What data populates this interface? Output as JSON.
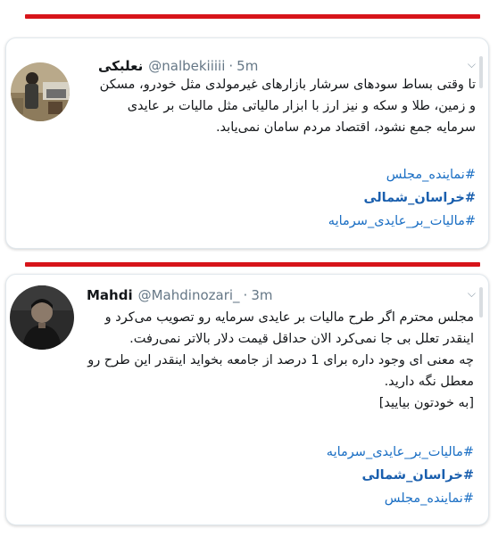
{
  "tweet1": {
    "display_name": "نعلبکی",
    "handle": "@nalbekiiiii",
    "time": "5m",
    "text": "تا وقتی بساط سودهای سرشار بازارهای غیرمولدی مثل خودرو، مسکن و زمین، طلا و سکه و نیز ارز با ابزار مالیاتی مثل مالیات بر عایدی سرمایه جمع نشود، اقتصاد مردم سامان نمی‌یابد.",
    "hashtags": [
      "#نماینده_مجلس",
      "#خراسان_شمالی",
      "#مالیات_بر_عایدی_سرمایه"
    ]
  },
  "tweet2": {
    "display_name": "Mahdi",
    "handle": "@Mahdinozari_",
    "time": "3m",
    "text_lines": [
      "مجلس محترم اگر طرح مالیات بر عایدی سرمایه رو تصویب می‌کرد و اینقدر تعلل بی جا نمی‌کرد الان حداقل قیمت دلار بالاتر نمی‌رفت.",
      "چه معنی ای وجود داره برای 1 درصد از جامعه بخواید اینقدر این طرح رو معطل نگه دارید.",
      "[به خودتون بیایید]"
    ],
    "hashtags": [
      "#مالیات_بر_عایدی_سرمایه",
      "#خراسان_شمالی",
      "#نماینده_مجلس"
    ]
  },
  "colors": {
    "divider_red": "#d7141a",
    "hashtag_blue": "#1b6fc4",
    "text": "#14171a",
    "muted": "#657786"
  },
  "icons": {
    "more": "chevron-down-icon"
  }
}
